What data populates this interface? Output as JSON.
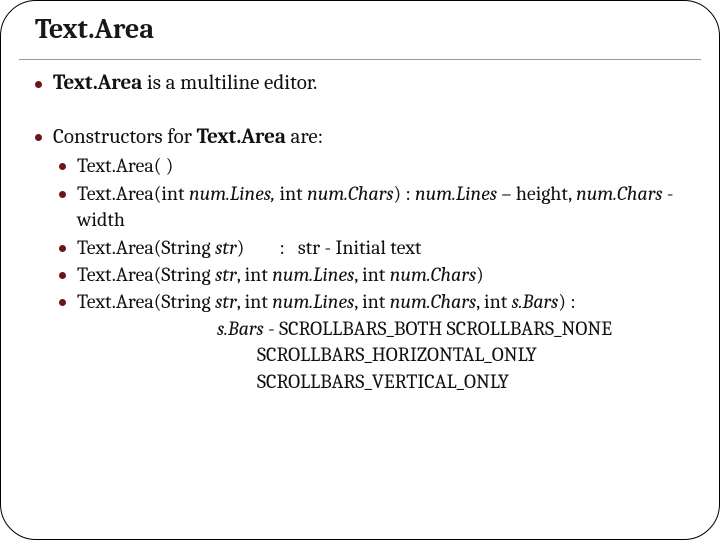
{
  "title": "Text.Area",
  "bullets": {
    "intro_bold": "Text.Area",
    "intro_rest": " is a multiline editor.",
    "ctor_prefix": "Constructors for ",
    "ctor_bold": "Text.Area",
    "ctor_suffix": " are:",
    "c1": "Text.Area( )",
    "c2_a": "Text.Area(int ",
    "c2_b": "num.Lines,",
    "c2_c": " int ",
    "c2_d": "num.Chars",
    "c2_e": ") : ",
    "c2_f": "num.Lines",
    "c2_g": " – height, ",
    "c2_h": "num.Chars",
    "c2_i": " - width",
    "c3_a": "Text.Area(String ",
    "c3_b": "str",
    "c3_c": ")",
    "c3_gap": "        :   str - Initial text",
    "c4_a": "Text.Area(String ",
    "c4_b": "str",
    "c4_c": ", int ",
    "c4_d": "num.Lines",
    "c4_e": ", int ",
    "c4_f": "num.Chars",
    "c4_g": ")",
    "c5_a": "Text.Area(String ",
    "c5_b": "str",
    "c5_c": ", int ",
    "c5_d": "num.Lines",
    "c5_e": ", int ",
    "c5_f": "num.Chars",
    "c5_g": ", int ",
    "c5_h": "s.Bars",
    "c5_i": ") :",
    "sbars_label_a": "s.Bars",
    "sbars_label_b": " -  SCROLLBARS_BOTH    SCROLLBARS_NONE",
    "sbars_line2": "SCROLLBARS_HORIZONTAL_ONLY",
    "sbars_line3": "SCROLLBARS_VERTICAL_ONLY"
  }
}
